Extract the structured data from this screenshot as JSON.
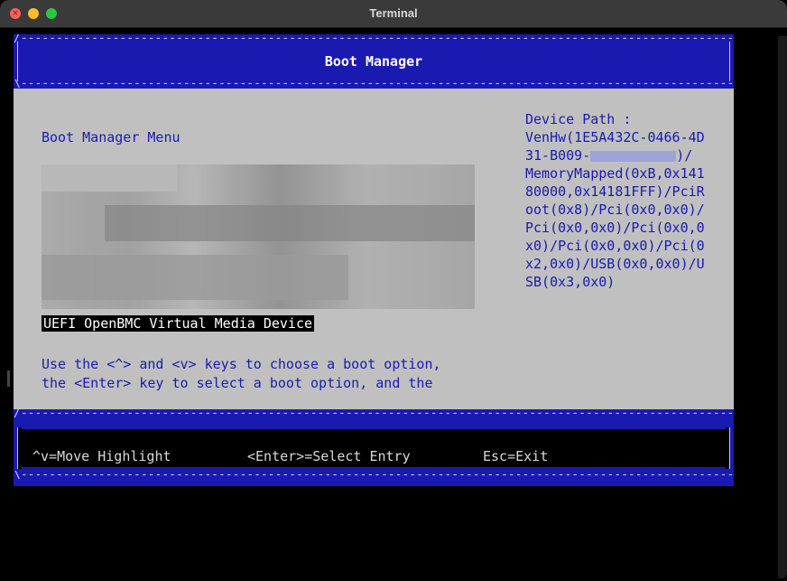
{
  "window": {
    "title": "Terminal",
    "buttons": [
      "close",
      "minimize",
      "maximize"
    ]
  },
  "header": {
    "title": "Boot Manager"
  },
  "menu": {
    "title": "Boot Manager Menu",
    "selected_item": "UEFI OpenBMC Virtual Media Device",
    "help_line_1": "Use the <^> and <v> keys to choose a boot option,",
    "help_line_2": "the <Enter> key to select a boot option, and the"
  },
  "device_path": {
    "label": "Device Path :",
    "lines": [
      "VenHw(1E5A432C-0466-4D",
      "31-B009-",
      "MemoryMapped(0xB,0x141",
      "80000,0x14181FFF)/PciR",
      "oot(0x8)/Pci(0x0,0x0)/",
      "Pci(0x0,0x0)/Pci(0x0,0",
      "x0)/Pci(0x0,0x0)/Pci(0",
      "x2,0x0)/USB(0x0,0x0)/U",
      "SB(0x3,0x0)"
    ],
    "line_2_suffix": ")/"
  },
  "footer": {
    "move_highlight": "^v=Move Highlight",
    "select_entry": "<Enter>=Select Entry",
    "exit": "Esc=Exit"
  },
  "colors": {
    "blue": "#1a1ab0",
    "gray_body": "#c0c0c0",
    "terminal_bg": "#000000"
  }
}
